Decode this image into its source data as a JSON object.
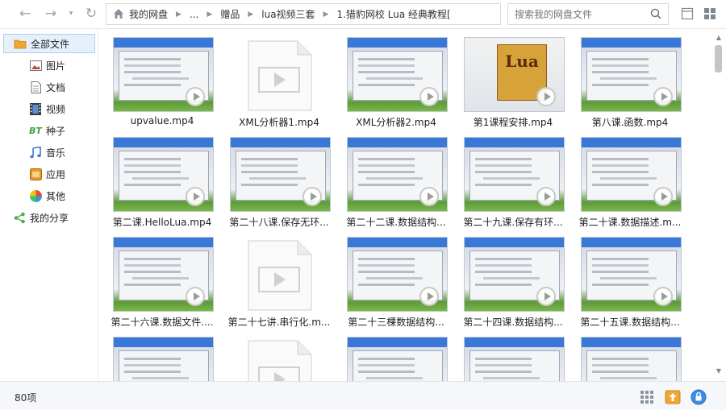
{
  "toolbar": {
    "breadcrumb": [
      "我的网盘",
      "...",
      "赠品",
      "lua视频三套",
      "1.猎豹网校 Lua 经典教程["
    ],
    "search_placeholder": "搜索我的网盘文件"
  },
  "sidebar": {
    "items": [
      {
        "label": "全部文件",
        "icon": "cloud-folder-icon",
        "active": true
      },
      {
        "label": "图片",
        "icon": "picture-icon"
      },
      {
        "label": "文档",
        "icon": "document-icon"
      },
      {
        "label": "视频",
        "icon": "film-icon"
      },
      {
        "label": "种子",
        "icon": "bt-icon",
        "glyph": "BT"
      },
      {
        "label": "音乐",
        "icon": "music-icon"
      },
      {
        "label": "应用",
        "icon": "app-icon"
      },
      {
        "label": "其他",
        "icon": "other-icon"
      },
      {
        "label": "我的分享",
        "icon": "share-icon"
      }
    ]
  },
  "files": [
    {
      "name": "upvalue.mp4",
      "thumb": "shot"
    },
    {
      "name": "XML分析器1.mp4",
      "thumb": "blank"
    },
    {
      "name": "XML分析器2.mp4",
      "thumb": "shot"
    },
    {
      "name": "第1课程安排.mp4",
      "thumb": "book",
      "cover_text": "Lua"
    },
    {
      "name": "第八课.函数.mp4",
      "thumb": "shot"
    },
    {
      "name": "第二课.HelloLua.mp4",
      "thumb": "shot"
    },
    {
      "name": "第二十八课.保存无环...",
      "thumb": "shot"
    },
    {
      "name": "第二十二课.数据结构...",
      "thumb": "shot"
    },
    {
      "name": "第二十九课.保存有环...",
      "thumb": "shot"
    },
    {
      "name": "第二十课.数据描述.m...",
      "thumb": "shot"
    },
    {
      "name": "第二十六课.数据文件....",
      "thumb": "shot"
    },
    {
      "name": "第二十七讲.串行化.m...",
      "thumb": "blank"
    },
    {
      "name": "第二十三棵数据结构...",
      "thumb": "shot"
    },
    {
      "name": "第二十四课.数据结构...",
      "thumb": "shot"
    },
    {
      "name": "第二十五课.数据结构...",
      "thumb": "shot"
    },
    {
      "name": "",
      "thumb": "shot"
    },
    {
      "name": "",
      "thumb": "blank"
    },
    {
      "name": "",
      "thumb": "shot"
    },
    {
      "name": "",
      "thumb": "shot"
    },
    {
      "name": "",
      "thumb": "shot"
    }
  ],
  "status": {
    "count": "80项"
  }
}
